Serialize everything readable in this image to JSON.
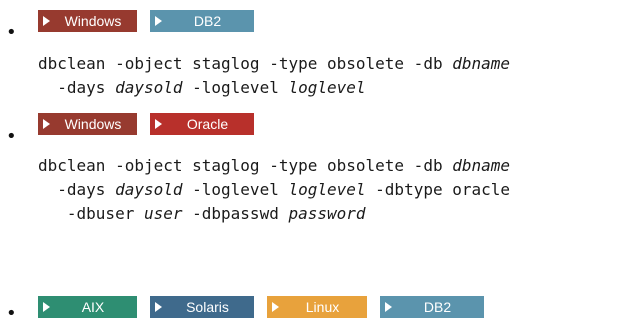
{
  "bullet_char": "•",
  "colors": {
    "windows": "#973a2f",
    "db2": "#5b94ad",
    "oracle": "#b8302b",
    "aix": "#2e8e72",
    "solaris": "#3f6a8c",
    "linux": "#e8a23c"
  },
  "sections": [
    {
      "badges": [
        {
          "label": "Windows",
          "color_key": "windows"
        },
        {
          "label": "DB2",
          "color_key": "db2"
        }
      ],
      "command": [
        [
          {
            "t": "dbclean -object staglog -type obsolete -db ",
            "i": false
          },
          {
            "t": "dbname",
            "i": true
          }
        ],
        [
          {
            "t": "  -days ",
            "i": false
          },
          {
            "t": "daysold",
            "i": true
          },
          {
            "t": " -loglevel ",
            "i": false
          },
          {
            "t": "loglevel",
            "i": true
          }
        ]
      ]
    },
    {
      "badges": [
        {
          "label": "Windows",
          "color_key": "windows"
        },
        {
          "label": "Oracle",
          "color_key": "oracle"
        }
      ],
      "command": [
        [
          {
            "t": "dbclean -object staglog -type obsolete -db ",
            "i": false
          },
          {
            "t": "dbname",
            "i": true
          }
        ],
        [
          {
            "t": "  -days ",
            "i": false
          },
          {
            "t": "daysold",
            "i": true
          },
          {
            "t": " -loglevel ",
            "i": false
          },
          {
            "t": "loglevel",
            "i": true
          },
          {
            "t": " -dbtype oracle",
            "i": false
          }
        ],
        [
          {
            "t": "   -dbuser ",
            "i": false
          },
          {
            "t": "user",
            "i": true
          },
          {
            "t": " -dbpasswd ",
            "i": false
          },
          {
            "t": "password",
            "i": true
          }
        ]
      ]
    },
    {
      "badges": [
        {
          "label": "AIX",
          "color_key": "aix"
        },
        {
          "label": "Solaris",
          "color_key": "solaris"
        },
        {
          "label": "Linux",
          "color_key": "linux"
        },
        {
          "label": "DB2",
          "color_key": "db2"
        }
      ],
      "command": []
    }
  ]
}
